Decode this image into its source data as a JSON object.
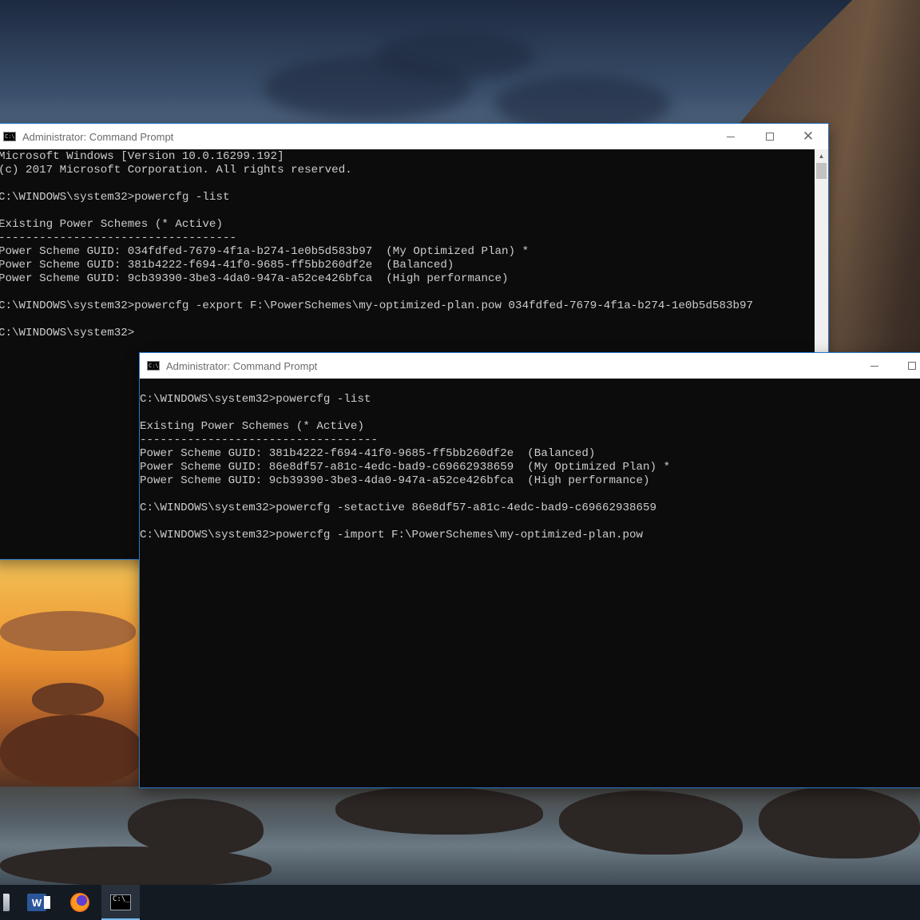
{
  "window_back": {
    "title": "Administrator: Command Prompt",
    "icon": "cmd-icon",
    "lines": [
      "Microsoft Windows [Version 10.0.16299.192]",
      "(c) 2017 Microsoft Corporation. All rights reserved.",
      "",
      "C:\\WINDOWS\\system32>powercfg -list",
      "",
      "Existing Power Schemes (* Active)",
      "-----------------------------------",
      "Power Scheme GUID: 034fdfed-7679-4f1a-b274-1e0b5d583b97  (My Optimized Plan) *",
      "Power Scheme GUID: 381b4222-f694-41f0-9685-ff5bb260df2e  (Balanced)",
      "Power Scheme GUID: 9cb39390-3be3-4da0-947a-a52ce426bfca  (High performance)",
      "",
      "C:\\WINDOWS\\system32>powercfg -export F:\\PowerSchemes\\my-optimized-plan.pow 034fdfed-7679-4f1a-b274-1e0b5d583b97",
      "",
      "C:\\WINDOWS\\system32>"
    ]
  },
  "window_front": {
    "title": "Administrator: Command Prompt",
    "icon": "cmd-icon",
    "lines": [
      "",
      "C:\\WINDOWS\\system32>powercfg -list",
      "",
      "Existing Power Schemes (* Active)",
      "-----------------------------------",
      "Power Scheme GUID: 381b4222-f694-41f0-9685-ff5bb260df2e  (Balanced)",
      "Power Scheme GUID: 86e8df57-a81c-4edc-bad9-c69662938659  (My Optimized Plan) *",
      "Power Scheme GUID: 9cb39390-3be3-4da0-947a-a52ce426bfca  (High performance)",
      "",
      "C:\\WINDOWS\\system32>powercfg -setactive 86e8df57-a81c-4edc-bad9-c69662938659",
      "",
      "C:\\WINDOWS\\system32>powercfg -import F:\\PowerSchemes\\my-optimized-plan.pow"
    ]
  },
  "taskbar": {
    "items": [
      {
        "icon": "file-explorer-icon"
      },
      {
        "icon": "word-icon",
        "label": "W"
      },
      {
        "icon": "firefox-icon"
      },
      {
        "icon": "command-prompt-icon",
        "label": "C:\\_",
        "active": true
      }
    ]
  },
  "colors": {
    "console_bg": "#0c0c0c",
    "console_text": "#cccccc",
    "titlebar_bg": "#ffffff",
    "accent": "#2b79c9",
    "taskbar_bg": "#141a22"
  }
}
